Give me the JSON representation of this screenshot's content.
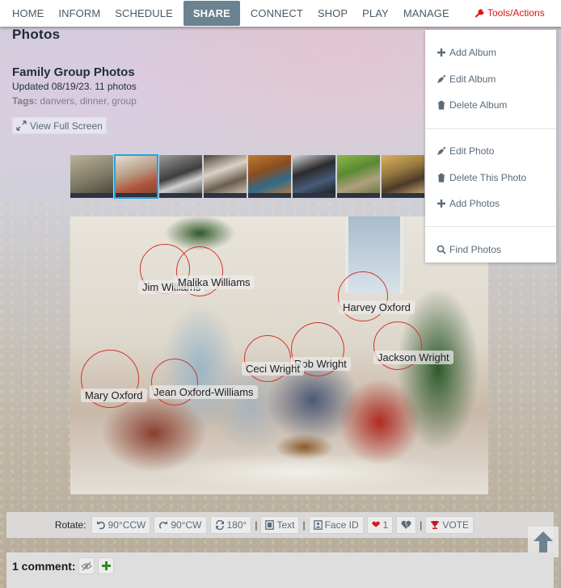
{
  "nav": {
    "items": [
      {
        "label": "HOME",
        "active": false
      },
      {
        "label": "INFORM",
        "active": false
      },
      {
        "label": "SCHEDULE",
        "active": false
      },
      {
        "label": "SHARE",
        "active": true
      },
      {
        "label": "CONNECT",
        "active": false
      },
      {
        "label": "SHOP",
        "active": false
      },
      {
        "label": "PLAY",
        "active": false
      },
      {
        "label": "MANAGE",
        "active": false
      }
    ],
    "tools_label": "Tools/Actions",
    "tools_icon": "wrench-icon",
    "active_color": "#6b8290",
    "tools_color": "#dd1111"
  },
  "page": {
    "title": "Photos"
  },
  "album": {
    "title": "Family Group Photos",
    "updated": "Updated 08/19/23. 11 photos",
    "tags_label": "Tags:",
    "tags": "danvers, dinner, group",
    "view_full_screen": "View Full Screen"
  },
  "thumbnails": {
    "count_visible": 8,
    "selected_index": 1
  },
  "photo": {
    "faces": [
      {
        "name": "Jim Williams"
      },
      {
        "name": "Malika Williams"
      },
      {
        "name": "Harvey Oxford"
      },
      {
        "name": "Jackson Wright"
      },
      {
        "name": "Rob Wright"
      },
      {
        "name": "Ceci Wright"
      },
      {
        "name": "Mary Oxford"
      },
      {
        "name": "Jean Oxford-Williams"
      }
    ]
  },
  "tools_menu": {
    "groups": [
      [
        {
          "label": "Add Album",
          "icon": "plus-icon"
        },
        {
          "label": "Edit Album",
          "icon": "pen-icon"
        },
        {
          "label": "Delete Album",
          "icon": "trash-icon"
        }
      ],
      [
        {
          "label": "Edit Photo",
          "icon": "pen-icon"
        },
        {
          "label": "Delete This Photo",
          "icon": "trash-icon"
        },
        {
          "label": "Add Photos",
          "icon": "plus-icon"
        }
      ],
      [
        {
          "label": "Find Photos",
          "icon": "search-icon"
        }
      ]
    ]
  },
  "action_bar": {
    "rotate_label": "Rotate:",
    "rotate_ccw": "90°CCW",
    "rotate_cw": "90°CW",
    "rotate_180": "180°",
    "separator": "|",
    "text_label": "Text",
    "face_id_label": "Face ID",
    "likes": "1",
    "vote_label": "VOTE"
  },
  "comments": {
    "label": "1 comment:"
  }
}
